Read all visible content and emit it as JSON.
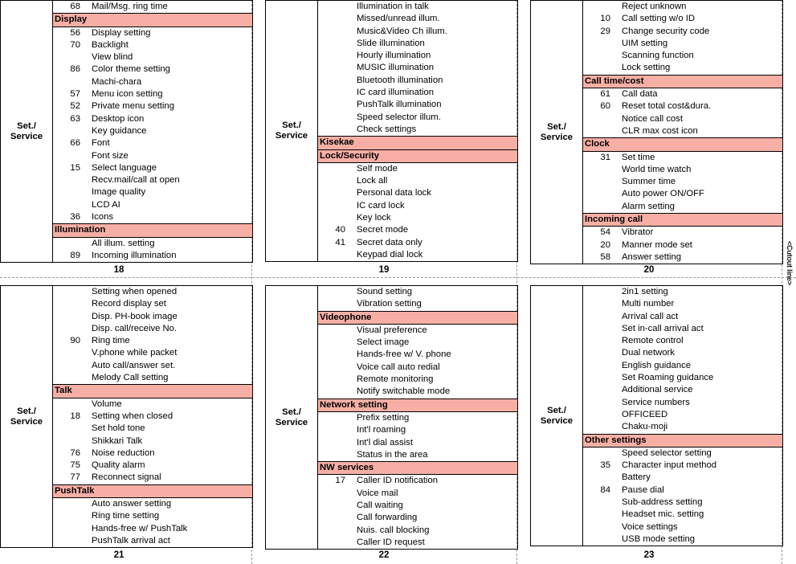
{
  "document": {
    "cut_line_label": "<Cutout line>",
    "category_label": "Set./\nService",
    "header_color": "#F7AFA5"
  },
  "panels": [
    {
      "page": "18",
      "category": "Set./Service",
      "rows": [
        {
          "type": "item",
          "num": "68",
          "label": "Mail/Msg. ring time"
        },
        {
          "type": "section",
          "num": "",
          "label": "Display"
        },
        {
          "type": "item",
          "num": "56",
          "label": "Display setting"
        },
        {
          "type": "item",
          "num": "70",
          "label": "Backlight"
        },
        {
          "type": "item",
          "num": "",
          "label": "View blind"
        },
        {
          "type": "item",
          "num": "86",
          "label": "Color theme setting"
        },
        {
          "type": "item",
          "num": "",
          "label": "Machi-chara"
        },
        {
          "type": "item",
          "num": "57",
          "label": "Menu icon setting"
        },
        {
          "type": "item",
          "num": "52",
          "label": "Private menu setting"
        },
        {
          "type": "item",
          "num": "63",
          "label": "Desktop icon"
        },
        {
          "type": "item",
          "num": "",
          "label": "Key guidance"
        },
        {
          "type": "item",
          "num": "66",
          "label": "Font"
        },
        {
          "type": "item",
          "num": "",
          "label": "Font size"
        },
        {
          "type": "item",
          "num": "15",
          "label": "Select language"
        },
        {
          "type": "item",
          "num": "",
          "label": "Recv.mail/call at open"
        },
        {
          "type": "item",
          "num": "",
          "label": "Image quality"
        },
        {
          "type": "item",
          "num": "",
          "label": "LCD AI"
        },
        {
          "type": "item",
          "num": "36",
          "label": "Icons"
        },
        {
          "type": "section",
          "num": "",
          "label": "Illumination"
        },
        {
          "type": "item",
          "num": "",
          "label": "All illum. setting"
        },
        {
          "type": "item",
          "num": "89",
          "label": "Incoming illumination"
        }
      ]
    },
    {
      "page": "19",
      "category": "Set./Service",
      "rows": [
        {
          "type": "item",
          "num": "",
          "label": "Illumination in talk"
        },
        {
          "type": "item",
          "num": "",
          "label": "Missed/unread illum."
        },
        {
          "type": "item",
          "num": "",
          "label": "Music&Video Ch illum."
        },
        {
          "type": "item",
          "num": "",
          "label": "Slide illumination"
        },
        {
          "type": "item",
          "num": "",
          "label": "Hourly illumination"
        },
        {
          "type": "item",
          "num": "",
          "label": "MUSIC illumination"
        },
        {
          "type": "item",
          "num": "",
          "label": "Bluetooth illumination"
        },
        {
          "type": "item",
          "num": "",
          "label": "IC card illumination"
        },
        {
          "type": "item",
          "num": "",
          "label": "PushTalk illumination"
        },
        {
          "type": "item",
          "num": "",
          "label": "Speed selector illum."
        },
        {
          "type": "item",
          "num": "",
          "label": "Check settings"
        },
        {
          "type": "section",
          "num": "",
          "label": "Kisekae"
        },
        {
          "type": "section",
          "num": "",
          "label": "Lock/Security"
        },
        {
          "type": "item",
          "num": "",
          "label": "Self mode"
        },
        {
          "type": "item",
          "num": "",
          "label": "Lock all"
        },
        {
          "type": "item",
          "num": "",
          "label": "Personal data lock"
        },
        {
          "type": "item",
          "num": "",
          "label": "IC card lock"
        },
        {
          "type": "item",
          "num": "",
          "label": "Key lock"
        },
        {
          "type": "item",
          "num": "40",
          "label": "Secret mode"
        },
        {
          "type": "item",
          "num": "41",
          "label": "Secret data only"
        },
        {
          "type": "item",
          "num": "",
          "label": "Keypad dial lock"
        }
      ]
    },
    {
      "page": "20",
      "category": "Set./Service",
      "rows": [
        {
          "type": "item",
          "num": "",
          "label": "Reject unknown"
        },
        {
          "type": "item",
          "num": "10",
          "label": "Call setting w/o ID"
        },
        {
          "type": "item",
          "num": "29",
          "label": "Change security code"
        },
        {
          "type": "item",
          "num": "",
          "label": "UIM setting"
        },
        {
          "type": "item",
          "num": "",
          "label": "Scanning function"
        },
        {
          "type": "item",
          "num": "",
          "label": "Lock setting"
        },
        {
          "type": "section",
          "num": "",
          "label": "Call time/cost"
        },
        {
          "type": "item",
          "num": "61",
          "label": "Call data"
        },
        {
          "type": "item",
          "num": "60",
          "label": "Reset total cost&dura."
        },
        {
          "type": "item",
          "num": "",
          "label": "Notice call cost"
        },
        {
          "type": "item",
          "num": "",
          "label": "CLR max cost icon"
        },
        {
          "type": "section",
          "num": "",
          "label": "Clock"
        },
        {
          "type": "item",
          "num": "31",
          "label": "Set time"
        },
        {
          "type": "item",
          "num": "",
          "label": "World time watch"
        },
        {
          "type": "item",
          "num": "",
          "label": "Summer time"
        },
        {
          "type": "item",
          "num": "",
          "label": "Auto power ON/OFF"
        },
        {
          "type": "item",
          "num": "",
          "label": "Alarm setting"
        },
        {
          "type": "section",
          "num": "",
          "label": "Incoming call"
        },
        {
          "type": "item",
          "num": "54",
          "label": "Vibrator"
        },
        {
          "type": "item",
          "num": "20",
          "label": "Manner mode set"
        },
        {
          "type": "item",
          "num": "58",
          "label": "Answer setting"
        }
      ]
    },
    {
      "page": "21",
      "category": "Set./Service",
      "rows": [
        {
          "type": "item",
          "num": "",
          "label": "Setting when opened"
        },
        {
          "type": "item",
          "num": "",
          "label": "Record display set"
        },
        {
          "type": "item",
          "num": "",
          "label": "Disp. PH-book image"
        },
        {
          "type": "item",
          "num": "",
          "label": "Disp. call/receive No."
        },
        {
          "type": "item",
          "num": "90",
          "label": "Ring time"
        },
        {
          "type": "item",
          "num": "",
          "label": "V.phone while packet"
        },
        {
          "type": "item",
          "num": "",
          "label": "Auto call/answer set."
        },
        {
          "type": "item",
          "num": "",
          "label": "Melody Call setting"
        },
        {
          "type": "section",
          "num": "",
          "label": "Talk"
        },
        {
          "type": "item",
          "num": "",
          "label": "Volume"
        },
        {
          "type": "item",
          "num": "18",
          "label": "Setting when closed"
        },
        {
          "type": "item",
          "num": "",
          "label": "Set hold tone"
        },
        {
          "type": "item",
          "num": "",
          "label": "Shikkari Talk"
        },
        {
          "type": "item",
          "num": "76",
          "label": "Noise reduction"
        },
        {
          "type": "item",
          "num": "75",
          "label": "Quality alarm"
        },
        {
          "type": "item",
          "num": "77",
          "label": "Reconnect signal"
        },
        {
          "type": "section",
          "num": "",
          "label": "PushTalk"
        },
        {
          "type": "item",
          "num": "",
          "label": "Auto answer setting"
        },
        {
          "type": "item",
          "num": "",
          "label": "Ring time setting"
        },
        {
          "type": "item",
          "num": "",
          "label": "Hands-free w/ PushTalk"
        },
        {
          "type": "item",
          "num": "",
          "label": "PushTalk arrival act"
        }
      ]
    },
    {
      "page": "22",
      "category": "Set./Service",
      "rows": [
        {
          "type": "item",
          "num": "",
          "label": "Sound setting"
        },
        {
          "type": "item",
          "num": "",
          "label": "Vibration setting"
        },
        {
          "type": "section",
          "num": "",
          "label": "Videophone"
        },
        {
          "type": "item",
          "num": "",
          "label": "Visual preference"
        },
        {
          "type": "item",
          "num": "",
          "label": "Select image"
        },
        {
          "type": "item",
          "num": "",
          "label": "Hands-free w/ V. phone"
        },
        {
          "type": "item",
          "num": "",
          "label": "Voice call auto redial"
        },
        {
          "type": "item",
          "num": "",
          "label": "Remote monitoring"
        },
        {
          "type": "item",
          "num": "",
          "label": "Notify switchable mode"
        },
        {
          "type": "section",
          "num": "",
          "label": "Network setting"
        },
        {
          "type": "item",
          "num": "",
          "label": "Prefix setting"
        },
        {
          "type": "item",
          "num": "",
          "label": "Int'l roaming"
        },
        {
          "type": "item",
          "num": "",
          "label": "Int'l dial assist"
        },
        {
          "type": "item",
          "num": "",
          "label": "Status in the area"
        },
        {
          "type": "section",
          "num": "",
          "label": "NW services"
        },
        {
          "type": "item",
          "num": "17",
          "label": "Caller ID notification"
        },
        {
          "type": "item",
          "num": "",
          "label": "Voice mail"
        },
        {
          "type": "item",
          "num": "",
          "label": "Call waiting"
        },
        {
          "type": "item",
          "num": "",
          "label": "Call forwarding"
        },
        {
          "type": "item",
          "num": "",
          "label": "Nuis. call blocking"
        },
        {
          "type": "item",
          "num": "",
          "label": "Caller ID request"
        }
      ]
    },
    {
      "page": "23",
      "category": "Set./Service",
      "rows": [
        {
          "type": "item",
          "num": "",
          "label": "2in1 setting"
        },
        {
          "type": "item",
          "num": "",
          "label": "Multi number"
        },
        {
          "type": "item",
          "num": "",
          "label": "Arrival call act"
        },
        {
          "type": "item",
          "num": "",
          "label": "Set in-call arrival act"
        },
        {
          "type": "item",
          "num": "",
          "label": "Remote control"
        },
        {
          "type": "item",
          "num": "",
          "label": "Dual network"
        },
        {
          "type": "item",
          "num": "",
          "label": "English guidance"
        },
        {
          "type": "item",
          "num": "",
          "label": "Set Roaming guidance"
        },
        {
          "type": "item",
          "num": "",
          "label": "Additional service"
        },
        {
          "type": "item",
          "num": "",
          "label": "Service numbers"
        },
        {
          "type": "item",
          "num": "",
          "label": "OFFICEED"
        },
        {
          "type": "item",
          "num": "",
          "label": "Chaku-moji"
        },
        {
          "type": "section",
          "num": "",
          "label": "Other settings"
        },
        {
          "type": "item",
          "num": "",
          "label": "Speed selector setting"
        },
        {
          "type": "item",
          "num": "35",
          "label": "Character input method"
        },
        {
          "type": "item",
          "num": "",
          "label": "Battery"
        },
        {
          "type": "item",
          "num": "84",
          "label": "Pause dial"
        },
        {
          "type": "item",
          "num": "",
          "label": "Sub-address setting"
        },
        {
          "type": "item",
          "num": "",
          "label": "Headset mic. setting"
        },
        {
          "type": "item",
          "num": "",
          "label": "Voice settings"
        },
        {
          "type": "item",
          "num": "",
          "label": "USB mode setting"
        }
      ]
    }
  ]
}
